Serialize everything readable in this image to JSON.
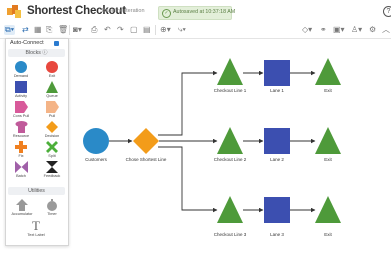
{
  "app": {
    "title": "Shortest Checkout",
    "subtitle": "Baseline Iteration",
    "autosave": "Autosaved at 10:37:18 AM"
  },
  "toolbar": {
    "items": [
      {
        "name": "blocks-toggle-icon"
      },
      {
        "name": "connect-icon"
      },
      {
        "name": "grid-icon"
      },
      {
        "name": "copy-icon"
      },
      {
        "name": "delete-icon"
      },
      {
        "name": "camera-icon"
      },
      {
        "name": "print-icon"
      },
      {
        "name": "undo-icon"
      },
      {
        "name": "redo-icon"
      },
      {
        "name": "save-icon"
      },
      {
        "name": "layout-icon"
      },
      {
        "name": "zoom-icon"
      },
      {
        "name": "route-icon"
      }
    ]
  },
  "sidebar": {
    "autoconnect_label": "Auto-Connect",
    "blocks_header": "Blocks",
    "blocks": [
      {
        "label": "Demand",
        "shape": "circle",
        "color": "#2a8ac8"
      },
      {
        "label": "Exit",
        "shape": "circle",
        "color": "#e8483e"
      },
      {
        "label": "Activity",
        "shape": "square",
        "color": "#3c4fb0"
      },
      {
        "label": "Queue",
        "shape": "triangle",
        "color": "#4e9a3a"
      },
      {
        "label": "Cons Pull",
        "shape": "pentagon",
        "color": "#d85a9a"
      },
      {
        "label": "Pull",
        "shape": "pentagon",
        "color": "#f4b487"
      },
      {
        "label": "Resource",
        "shape": "resource",
        "color": "#c05a9a"
      },
      {
        "label": "Decision",
        "shape": "diamond",
        "color": "#f39c1a"
      },
      {
        "label": "Fix",
        "shape": "cross",
        "color": "#f08020"
      },
      {
        "label": "Split",
        "shape": "x",
        "color": "#4caf3a"
      },
      {
        "label": "Batch",
        "shape": "bowtie",
        "color": "#a060a8"
      },
      {
        "label": "Feedback",
        "shape": "hourglass",
        "color": "#222222"
      }
    ],
    "utilities_header": "Utilities",
    "utilities": [
      {
        "label": "Accumulator"
      },
      {
        "label": "Timer"
      },
      {
        "label": "Text Label"
      }
    ]
  },
  "canvas": {
    "nodes": {
      "customers": "Customers",
      "choose": "Chose Shortest Line",
      "checkout1": "Checkout Line 1",
      "lane1": "Lane 1",
      "exit1": "Exit",
      "checkout2": "Checkout Line 2",
      "lane2": "Lane 2",
      "exit2": "Exit",
      "checkout3": "Checkout Line 3",
      "lane3": "Lane 3",
      "exit3": "Exit"
    }
  },
  "colors": {
    "demand": "#2a8ac8",
    "decision": "#f39c1a",
    "queue": "#4e9a3a",
    "activity": "#3c4fb0",
    "accent": "#2b6cb0"
  }
}
